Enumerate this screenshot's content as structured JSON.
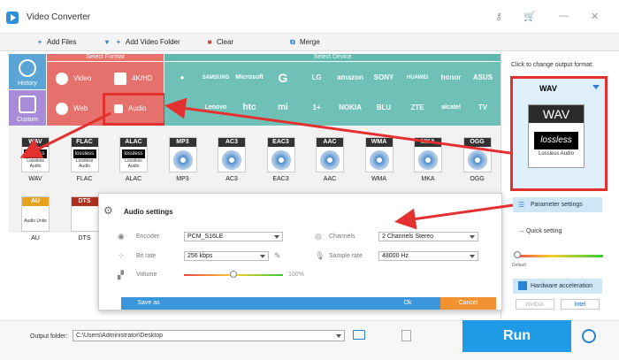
{
  "app": {
    "title": "Video Converter"
  },
  "toolbar": {
    "add_files": "Add Files",
    "add_folder": "Add Video Folder",
    "clear": "Clear",
    "merge": "Merge"
  },
  "side": {
    "history": "History",
    "custom": "Custom"
  },
  "format_panel": {
    "select_format": "Select Format",
    "select_device": "Select Device",
    "categories": {
      "video": "Video",
      "hd": "4K/HD",
      "web": "Web",
      "audio": "Audio"
    }
  },
  "devices": {
    "row1": [
      "",
      "SAMSUNG",
      "Microsoft",
      "G",
      "LG",
      "amazon",
      "SONY",
      "HUAWEI",
      "honor",
      "ASUS"
    ],
    "row2": [
      "",
      "Lenovo",
      "htc",
      "mi",
      "1+",
      "NOKIA",
      "BLU",
      "ZTE",
      "alcatel",
      "TV"
    ]
  },
  "formats": {
    "row1": [
      "WAV",
      "FLAC",
      "ALAC",
      "MP3",
      "AC3",
      "EAC3",
      "AAC",
      "WMA",
      "MKA",
      "OGG"
    ],
    "row2": [
      "AU",
      "DTS"
    ],
    "lossless": "lossless",
    "lossless_audio": "Lossless Audio",
    "audio_units": "Audio Units"
  },
  "output_format": {
    "hint": "Click to change output format:",
    "selected": "WAV",
    "icon_top": "WAV",
    "icon_lossless": "lossless",
    "icon_sub": "Lossless Audio"
  },
  "right": {
    "param_settings": "Parameter settings",
    "quick_setting": "Quick setting",
    "default": "Default",
    "hw_accel": "Hardware acceleration",
    "nvidia": "NVIDIA",
    "intel": "Intel"
  },
  "audio_settings": {
    "title": "Audio settings",
    "encoder_label": "Encoder",
    "encoder_value": "PCM_S16LE",
    "bitrate_label": "Bit rate",
    "bitrate_value": "256 kbps",
    "volume_label": "Volume",
    "volume_value": "100%",
    "volume_level": 0.5,
    "channels_label": "Channels",
    "channels_value": "2 Channels Stereo",
    "samplerate_label": "Sample rate",
    "samplerate_value": "48000 Hz",
    "save_as": "Save as",
    "ok": "Ok",
    "cancel": "Cancel"
  },
  "output": {
    "label": "Output folder:",
    "path": "C:\\Users\\Administrator\\Desktop"
  },
  "run": "Run",
  "colors": {
    "accent": "#1e9ae6",
    "format_red": "#e6706b",
    "device_teal": "#6fc1b8",
    "highlight_red": "#e53030",
    "cancel_orange": "#f39233"
  }
}
